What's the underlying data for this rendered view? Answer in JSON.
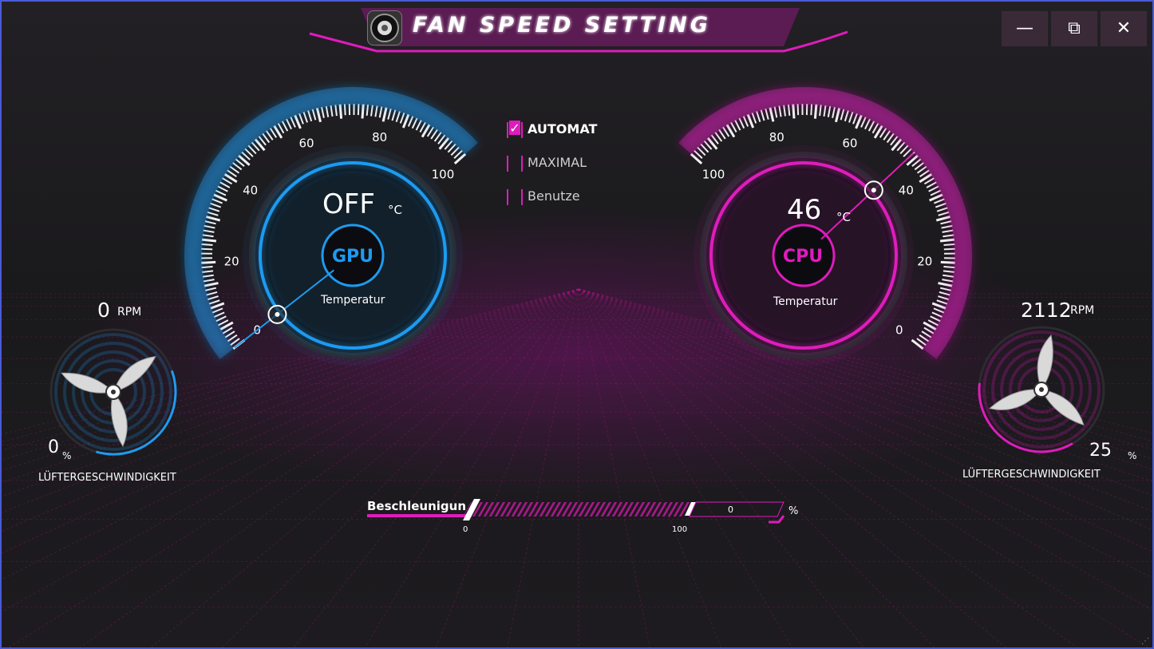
{
  "window": {
    "title": "FAN SPEED SETTING",
    "buttons": {
      "minimize": "—",
      "maximize": "⧉",
      "close": "✕"
    }
  },
  "gpu": {
    "label": "GPU",
    "temp_value": "OFF",
    "temp_unit": "°C",
    "caption": "Temperatur",
    "gauge_ticks": [
      "0",
      "20",
      "40",
      "60",
      "80",
      "100"
    ],
    "needle_value": 0,
    "accent": "#1e9bf0"
  },
  "cpu": {
    "label": "CPU",
    "temp_value": "46",
    "temp_unit": "°C",
    "caption": "Temperatur",
    "gauge_ticks": [
      "0",
      "20",
      "40",
      "60",
      "80",
      "100"
    ],
    "needle_value": 46,
    "accent": "#e01bbd"
  },
  "fan_left": {
    "rpm_value": "0",
    "rpm_unit": "RPM",
    "pct_value": "0",
    "pct_unit": "%",
    "caption": "LÜFTERGESCHWINDIGKEIT",
    "level": 0
  },
  "fan_right": {
    "rpm_value": "2112",
    "rpm_unit": "RPM",
    "pct_value": "25",
    "pct_unit": "%",
    "caption": "LÜFTERGESCHWINDIGKEIT",
    "level": 25
  },
  "modes": [
    {
      "label": "AUTOMAT",
      "checked": true
    },
    {
      "label": "MAXIMAL",
      "checked": false
    },
    {
      "label": "Benutze",
      "checked": false
    }
  ],
  "acceleration": {
    "label": "Beschleunigun",
    "min": "0",
    "max": "100",
    "value": "0",
    "unit": "%"
  }
}
